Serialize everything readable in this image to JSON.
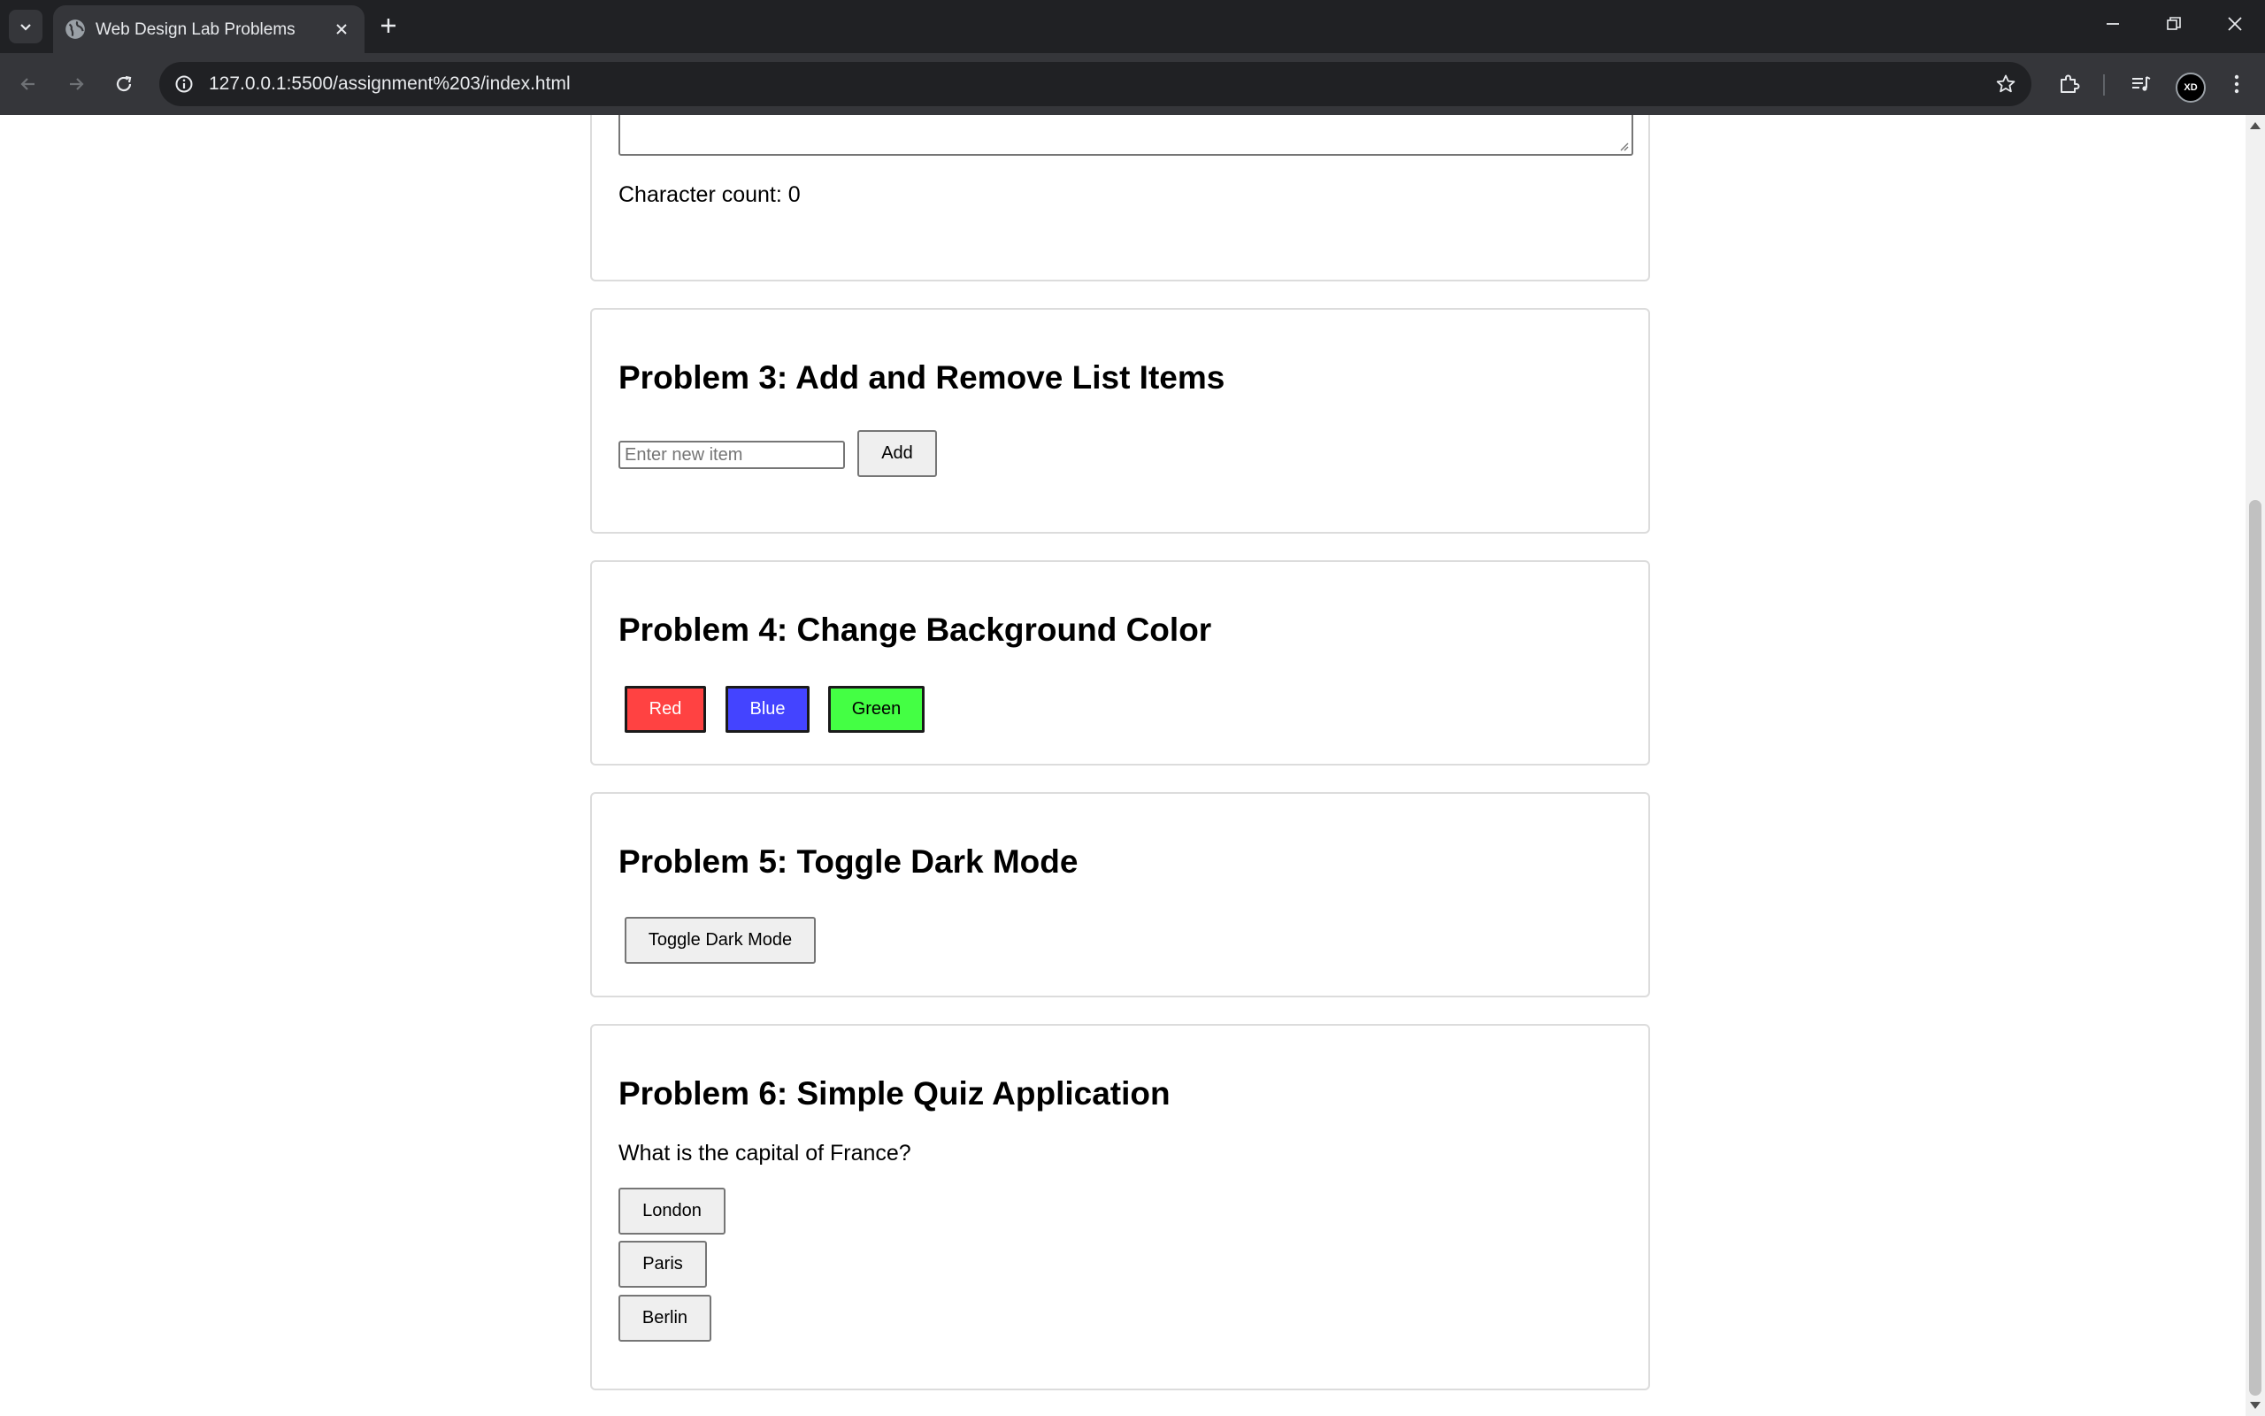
{
  "browser": {
    "tab_title": "Web Design Lab Problems",
    "url": "127.0.0.1:5500/assignment%203/index.html",
    "profile_label": "XD"
  },
  "colors": {
    "red_button": "#ff4242",
    "blue_button": "#4444ff",
    "green_button": "#44ff44"
  },
  "problem2": {
    "char_count_text": "Character count: 0"
  },
  "problem3": {
    "title": "Problem 3: Add and Remove List Items",
    "input_placeholder": "Enter new item",
    "add_label": "Add"
  },
  "problem4": {
    "title": "Problem 4: Change Background Color",
    "buttons": [
      "Red",
      "Blue",
      "Green"
    ]
  },
  "problem5": {
    "title": "Problem 5: Toggle Dark Mode",
    "toggle_label": "Toggle Dark Mode"
  },
  "problem6": {
    "title": "Problem 6: Simple Quiz Application",
    "question": "What is the capital of France?",
    "options": [
      "London",
      "Paris",
      "Berlin"
    ]
  }
}
